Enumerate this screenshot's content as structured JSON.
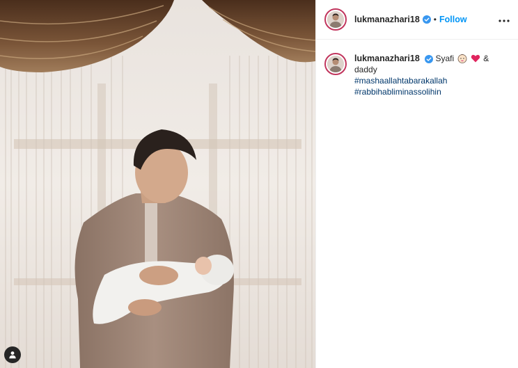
{
  "post": {
    "author": {
      "username": "lukmanazhari18",
      "verified": true,
      "follow_label": "Follow",
      "separator": "•",
      "more_icon": "more-horizontal-icon"
    },
    "caption": {
      "username": "lukmanazhari18",
      "text_before_emoji": "Syafi",
      "emojis": [
        "baby-face-emoji",
        "red-heart-emoji"
      ],
      "text_after_emoji": "& daddy",
      "hashtags": [
        "#mashaallahtabarakallah",
        "#rabbihabliminassolihin"
      ]
    },
    "photo": {
      "tag_icon": "user-tag-icon"
    }
  },
  "colors": {
    "accent": "#0095f6",
    "hashtag": "#00376b",
    "avatar_ring": "#c1355d",
    "verified": "#3897f0",
    "heart": "#e0245e"
  }
}
